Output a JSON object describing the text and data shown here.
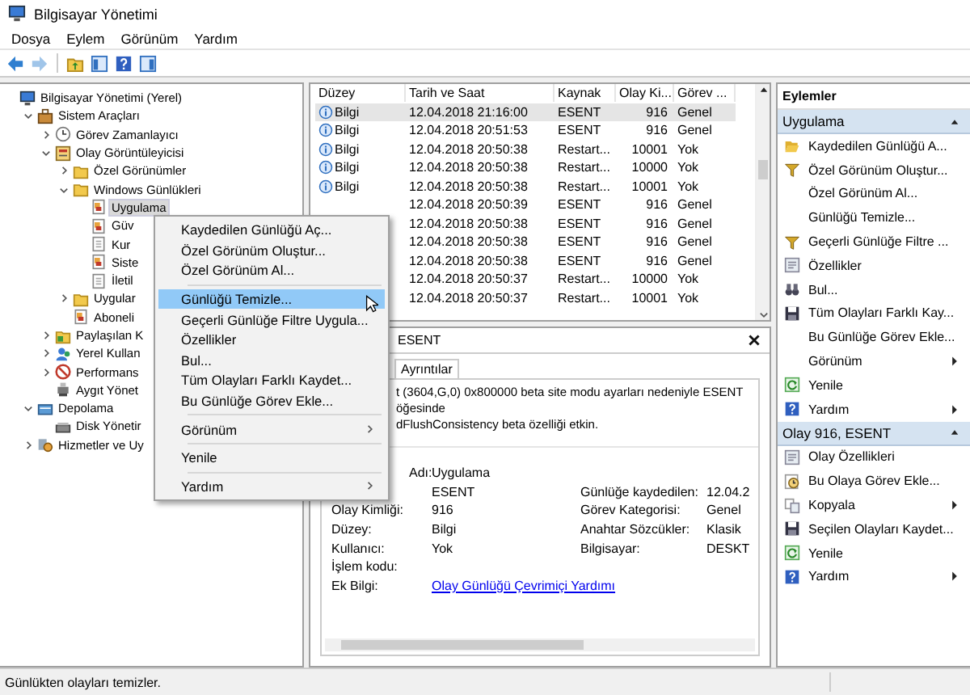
{
  "window": {
    "title": "Bilgisayar Yönetimi"
  },
  "menu_bar": [
    "Dosya",
    "Eylem",
    "Görünüm",
    "Yardım"
  ],
  "toolbar": [
    {
      "kind": "back",
      "disabled": false
    },
    {
      "kind": "forward",
      "disabled": true
    },
    {
      "kind": "up",
      "disabled": false
    },
    {
      "kind": "console-tree",
      "disabled": false
    },
    {
      "kind": "help",
      "disabled": false
    },
    {
      "kind": "action-pane",
      "disabled": false
    }
  ],
  "tree": {
    "items": [
      {
        "label": "Bilgisayar Yönetimi (Yerel)",
        "kind": "computer",
        "selected": false,
        "children": [
          {
            "label": "Sistem Araçları",
            "kind": "tools",
            "expanded": true,
            "selected": false,
            "children": [
              {
                "label": "Görev Zamanlayıcı",
                "kind": "clock",
                "expanded": false,
                "selected": false
              },
              {
                "label": "Olay Görüntüleyicisi",
                "kind": "viewer",
                "expanded": true,
                "selected": false,
                "children": [
                  {
                    "label": "Özel Görünümler",
                    "kind": "folder",
                    "expanded": false,
                    "selected": false
                  },
                  {
                    "label": "Windows Günlükleri",
                    "kind": "folder",
                    "expanded": true,
                    "selected": false,
                    "children": [
                      {
                        "label": "Uygulama",
                        "kind": "log",
                        "selected": true
                      },
                      {
                        "label": "Güv",
                        "kind": "log",
                        "selected": false
                      },
                      {
                        "label": "Kur",
                        "kind": "page",
                        "selected": false
                      },
                      {
                        "label": "Siste",
                        "kind": "log",
                        "selected": false
                      },
                      {
                        "label": "İletil",
                        "kind": "page",
                        "selected": false
                      }
                    ]
                  },
                  {
                    "label": "Uygular",
                    "kind": "folder",
                    "expanded": false,
                    "selected": false
                  },
                  {
                    "label": "Aboneli",
                    "kind": "log",
                    "selected": false
                  }
                ]
              },
              {
                "label": "Paylaşılan K",
                "kind": "share",
                "expanded": false,
                "selected": false
              },
              {
                "label": "Yerel Kullan",
                "kind": "users",
                "expanded": false,
                "selected": false
              },
              {
                "label": "Performans",
                "kind": "performance",
                "expanded": false,
                "selected": false
              },
              {
                "label": "Aygıt Yönet",
                "kind": "device",
                "selected": false
              }
            ]
          },
          {
            "label": "Depolama",
            "kind": "storage",
            "expanded": true,
            "selected": false,
            "children": [
              {
                "label": "Disk Yönetir",
                "kind": "disk",
                "selected": false
              }
            ]
          },
          {
            "label": "Hizmetler ve Uy",
            "kind": "services",
            "expanded": false,
            "selected": false
          }
        ]
      }
    ]
  },
  "events": {
    "columns": [
      "Düzey",
      "Tarih ve Saat",
      "Kaynak",
      "Olay Ki...",
      "Görev ..."
    ],
    "rows": [
      {
        "level": "Bilgi",
        "date": "12.04.2018 21:16:00",
        "source": "ESENT",
        "event_id": "916",
        "task": "Genel",
        "selected": true
      },
      {
        "level": "Bilgi",
        "date": "12.04.2018 20:51:53",
        "source": "ESENT",
        "event_id": "916",
        "task": "Genel",
        "selected": false
      },
      {
        "level": "Bilgi",
        "date": "12.04.2018 20:50:38",
        "source": "Restart...",
        "event_id": "10001",
        "task": "Yok",
        "selected": false
      },
      {
        "level": "Bilgi",
        "date": "12.04.2018 20:50:38",
        "source": "Restart...",
        "event_id": "10000",
        "task": "Yok",
        "selected": false
      },
      {
        "level": "Bilgi",
        "date": "12.04.2018 20:50:38",
        "source": "Restart...",
        "event_id": "10001",
        "task": "Yok",
        "selected": false
      },
      {
        "date": "12.04.2018 20:50:39",
        "source": "ESENT",
        "event_id": "916",
        "task": "Genel",
        "selected": false
      },
      {
        "date": "12.04.2018 20:50:38",
        "source": "ESENT",
        "event_id": "916",
        "task": "Genel",
        "selected": false
      },
      {
        "date": "12.04.2018 20:50:38",
        "source": "ESENT",
        "event_id": "916",
        "task": "Genel",
        "selected": false
      },
      {
        "date": "12.04.2018 20:50:38",
        "source": "ESENT",
        "event_id": "916",
        "task": "Genel",
        "selected": false
      },
      {
        "date": "12.04.2018 20:50:37",
        "source": "Restart...",
        "event_id": "10000",
        "task": "Yok",
        "selected": false
      },
      {
        "date": "12.04.2018 20:50:37",
        "source": "Restart...",
        "event_id": "10001",
        "task": "Yok",
        "selected": false
      }
    ]
  },
  "detail": {
    "title": "ESENT",
    "tabs": [
      {
        "label": "Ayrıntılar",
        "selected": false
      }
    ],
    "message_lines": [
      "t (3604,G,0) 0x800000 beta site modu ayarları nedeniyle ESENT öğesinde",
      "dFlushConsistency beta özelliği etkin."
    ],
    "fields": [
      {
        "label": "Adı:",
        "value": "Uygulama"
      },
      {
        "value": "ESENT",
        "label_2": "Günlüğe kaydedilen:",
        "value_2": "12.04.2"
      },
      {
        "label": "Olay Kimliği:",
        "value": "916",
        "label_2": "Görev Kategorisi:",
        "value_2": "Genel"
      },
      {
        "label": "Düzey:",
        "value": "Bilgi",
        "label_2": "Anahtar Sözcükler:",
        "value_2": "Klasik"
      },
      {
        "label": "Kullanıcı:",
        "value": "Yok",
        "label_2": "Bilgisayar:",
        "value_2": "DESKT"
      },
      {
        "label": "İşlem kodu:"
      },
      {
        "label": "Ek Bilgi:",
        "link": "Olay Günlüğü Çevrimiçi Yardımı"
      }
    ]
  },
  "actions": {
    "title": "Eylemler",
    "sections": [
      {
        "title": "Uygulama",
        "expanded": true,
        "items": [
          {
            "label": "Kaydedilen Günlüğü A...",
            "kind": "open",
            "submenu": false
          },
          {
            "label": "Özel Görünüm Oluştur...",
            "kind": "filter",
            "submenu": false
          },
          {
            "label": "Özel Görünüm Al...",
            "submenu": false
          },
          {
            "label": "Günlüğü Temizle...",
            "submenu": false
          },
          {
            "label": "Geçerli Günlüğe Filtre ...",
            "kind": "filter",
            "submenu": false
          },
          {
            "label": "Özellikler",
            "kind": "properties",
            "submenu": false
          },
          {
            "label": "Bul...",
            "kind": "find",
            "submenu": false
          },
          {
            "label": "Tüm Olayları Farklı Kay...",
            "kind": "save",
            "submenu": false
          },
          {
            "label": "Bu Günlüğe Görev Ekle...",
            "submenu": false
          },
          {
            "label": "Görünüm",
            "submenu": true
          },
          {
            "label": "Yenile",
            "kind": "refresh",
            "submenu": false
          },
          {
            "label": "Yardım",
            "kind": "help",
            "submenu": true
          }
        ]
      },
      {
        "title": "Olay 916, ESENT",
        "expanded": true,
        "items": [
          {
            "label": "Olay Özellikleri",
            "kind": "properties",
            "submenu": false
          },
          {
            "label": "Bu Olaya Görev Ekle...",
            "kind": "task",
            "submenu": false
          },
          {
            "label": "Kopyala",
            "kind": "copy",
            "submenu": true
          },
          {
            "label": "Seçilen Olayları Kaydet...",
            "kind": "save",
            "submenu": false
          },
          {
            "label": "Yenile",
            "kind": "refresh",
            "submenu": false
          },
          {
            "label": "Yardım",
            "kind": "help",
            "submenu": true
          }
        ]
      }
    ]
  },
  "context_menu": [
    {
      "kind": "item",
      "label": "Kaydedilen Günlüğü Aç...",
      "selected": false,
      "submenu": false
    },
    {
      "kind": "item",
      "label": "Özel Görünüm Oluştur...",
      "selected": false,
      "submenu": false
    },
    {
      "kind": "item",
      "label": "Özel Görünüm Al...",
      "selected": false,
      "submenu": false
    },
    {
      "kind": "separator"
    },
    {
      "kind": "item",
      "label": "Günlüğü Temizle...",
      "selected": true,
      "submenu": false
    },
    {
      "kind": "item",
      "label": "Geçerli Günlüğe Filtre Uygula...",
      "selected": false,
      "submenu": false
    },
    {
      "kind": "item",
      "label": "Özellikler",
      "selected": false,
      "submenu": false
    },
    {
      "kind": "item",
      "label": "Bul...",
      "selected": false,
      "submenu": false
    },
    {
      "kind": "item",
      "label": "Tüm Olayları Farklı Kaydet...",
      "selected": false,
      "submenu": false
    },
    {
      "kind": "item",
      "label": "Bu Günlüğe Görev Ekle...",
      "selected": false,
      "submenu": false
    },
    {
      "kind": "separator"
    },
    {
      "kind": "item",
      "label": "Görünüm",
      "selected": false,
      "submenu": true
    },
    {
      "kind": "separator"
    },
    {
      "kind": "item",
      "label": "Yenile",
      "selected": false,
      "submenu": false
    },
    {
      "kind": "separator"
    },
    {
      "kind": "item",
      "label": "Yardım",
      "selected": false,
      "submenu": true
    }
  ],
  "status_bar": "Günlükten olayları temizler."
}
